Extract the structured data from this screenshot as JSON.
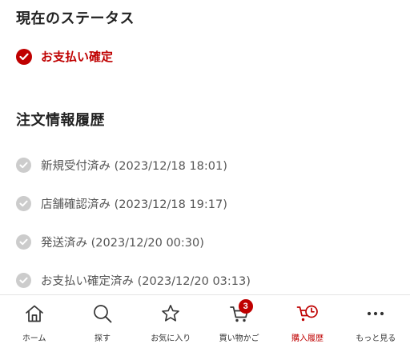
{
  "colors": {
    "accent": "#bf0000",
    "done_check": "#cccccc",
    "text_dark": "#222222",
    "text_muted": "#555555"
  },
  "status_section": {
    "title": "現在のステータス",
    "current_status": {
      "icon": "check-circle-icon",
      "label": "お支払い確定"
    }
  },
  "history_section": {
    "title": "注文情報履歴",
    "items": [
      {
        "icon": "check-circle-icon",
        "label": "新規受付済み (2023/12/18 18:01)"
      },
      {
        "icon": "check-circle-icon",
        "label": "店舗確認済み (2023/12/18 19:17)"
      },
      {
        "icon": "check-circle-icon",
        "label": "発送済み (2023/12/20 00:30)"
      },
      {
        "icon": "check-circle-icon",
        "label": "お支払い確定済み (2023/12/20 03:13)"
      }
    ]
  },
  "tabbar": {
    "tabs": [
      {
        "icon": "home-icon",
        "label": "ホーム"
      },
      {
        "icon": "search-icon",
        "label": "探す"
      },
      {
        "icon": "star-icon",
        "label": "お気に入り"
      },
      {
        "icon": "cart-icon",
        "label": "買い物かご",
        "badge": "3"
      },
      {
        "icon": "purchase-history-icon",
        "label": "購入履歴",
        "active": true
      },
      {
        "icon": "more-icon",
        "label": "もっと見る"
      }
    ]
  }
}
